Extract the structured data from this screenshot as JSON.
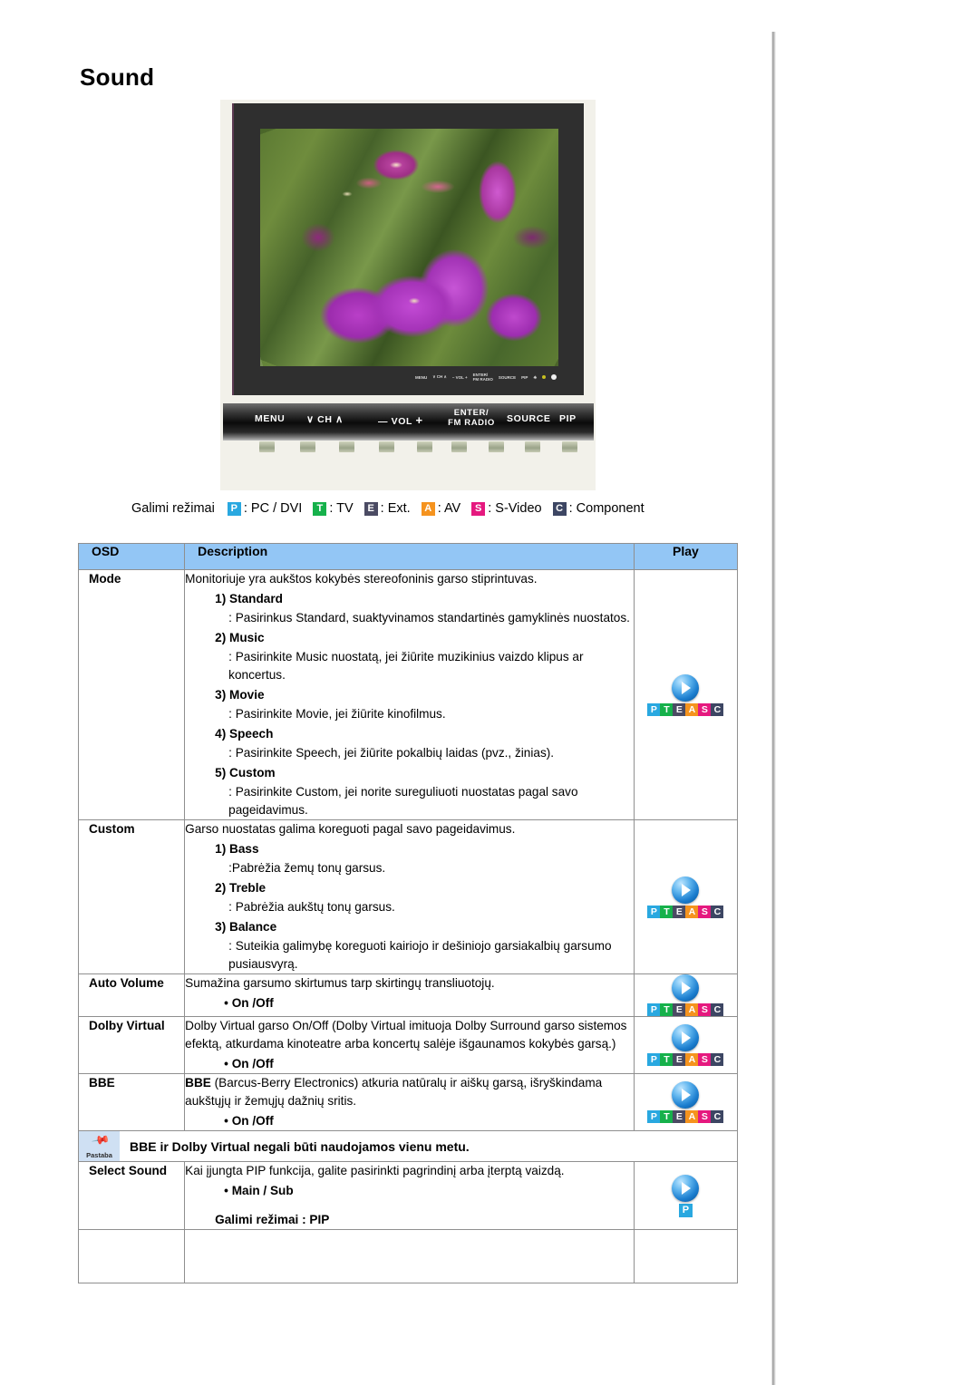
{
  "page": {
    "title": "Sound"
  },
  "monitor": {
    "osd_strip": [
      "MENU",
      "CH",
      "VOL",
      "ENTER/ FM RADIO",
      "SOURCE",
      "PIP"
    ],
    "controls": [
      {
        "label": "MENU"
      },
      {
        "label": "CH",
        "left_chevron": "∨",
        "right_chevron": "∧"
      },
      {
        "label": "VOL",
        "minus": "—",
        "plus": "+"
      },
      {
        "label": "ENTER/",
        "label2": "FM RADIO"
      },
      {
        "label": "SOURCE"
      },
      {
        "label": "PIP"
      },
      {
        "label": "⏻"
      }
    ]
  },
  "legend": {
    "label": "Galimi režimai",
    "items": [
      {
        "code": "P",
        "text": ": PC / DVI",
        "color": "#29a8e0"
      },
      {
        "code": "T",
        "text": ": TV",
        "color": "#16b14b"
      },
      {
        "code": "E",
        "text": ": Ext.",
        "color": "#4b4b63"
      },
      {
        "code": "A",
        "text": ": AV",
        "color": "#f5931e"
      },
      {
        "code": "S",
        "text": ": S-Video",
        "color": "#e5197f"
      },
      {
        "code": "C",
        "text": ": Component",
        "color": "#3d4663"
      }
    ]
  },
  "table": {
    "header_bg": "#93c6f5",
    "columns": [
      "OSD",
      "Description",
      "Play"
    ],
    "rows": [
      {
        "osd": "Mode",
        "lead": "Monitoriuje yra aukštos kokybės stereofoninis garso stiprintuvas.",
        "items": [
          {
            "title": "1) Standard",
            "desc": ": Pasirinkus Standard, suaktyvinamos standartinės gamyklinės nuostatos."
          },
          {
            "title": "2) Music",
            "desc": ": Pasirinkite Music nuostatą, jei žiūrite muzikinius vaizdo klipus ar koncertus."
          },
          {
            "title": "3) Movie",
            "desc": ": Pasirinkite Movie, jei žiūrite kinofilmus."
          },
          {
            "title": "4) Speech",
            "desc": ": Pasirinkite Speech, jei žiūrite pokalbių laidas (pvz., žinias)."
          },
          {
            "title": "5) Custom",
            "desc": ": Pasirinkite Custom, jei norite sureguliuoti nuostatas pagal savo pageidavimus."
          }
        ],
        "play_badges": "PTEASC"
      },
      {
        "osd": "Custom",
        "lead": "Garso nuostatas galima koreguoti pagal savo pageidavimus.",
        "items": [
          {
            "title": "1) Bass",
            "desc": ":Pabrėžia žemų tonų garsus."
          },
          {
            "title": "2) Treble",
            "desc": ": Pabrėžia aukštų tonų garsus."
          },
          {
            "title": "3) Balance",
            "desc": ": Suteikia galimybę koreguoti kairiojo ir dešiniojo garsiakalbių garsumo pusiausvyrą."
          }
        ],
        "play_badges": "PTEASC"
      },
      {
        "osd": "Auto Volume",
        "lead": "Sumažina garsumo skirtumus tarp skirtingų transliuotojų.",
        "bullet": "• On /Off",
        "play_badges": "PTEASC"
      },
      {
        "osd": "Dolby Virtual",
        "lead": "Dolby Virtual garso On/Off (Dolby Virtual imituoja Dolby Surround garso sistemos efektą, atkurdama kinoteatre arba koncertų salėje išgaunamos kokybės garsą.)",
        "bullet": "• On /Off",
        "play_badges": "PTEASC"
      },
      {
        "osd": "BBE",
        "lead_strong": "BBE",
        "lead": " (Barcus-Berry Electronics) atkuria natūralų ir aiškų garsą, išryškindama aukštųjų ir žemųjų dažnių sritis.",
        "bullet": "• On /Off",
        "play_badges": "PTEASC"
      }
    ],
    "note": {
      "icon_label": "Pastaba",
      "text": "BBE ir Dolby Virtual negali būti naudojamos vienu metu."
    },
    "select_sound": {
      "osd": "Select Sound",
      "lead": "Kai įjungta PIP funkcija, galite pasirinkti pagrindinį arba įterptą vaizdą.",
      "bullet": "• Main / Sub",
      "modes": "Galimi režimai : PIP",
      "play_badges": "P"
    }
  }
}
